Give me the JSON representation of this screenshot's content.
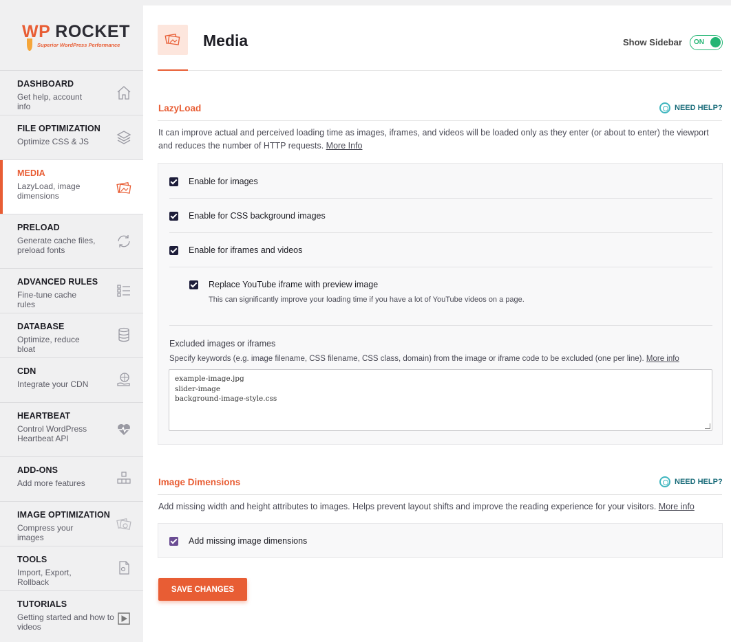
{
  "logo": {
    "part1": "WP",
    "part2": "ROCKET",
    "tagline": "Superior WordPress Performance"
  },
  "sidebar": {
    "items": [
      {
        "title": "DASHBOARD",
        "sub": "Get help, account info",
        "icon": "home-icon"
      },
      {
        "title": "FILE OPTIMIZATION",
        "sub": "Optimize CSS & JS",
        "icon": "layers-icon"
      },
      {
        "title": "MEDIA",
        "sub": "LazyLoad, image dimensions",
        "icon": "images-icon",
        "active": true
      },
      {
        "title": "PRELOAD",
        "sub": "Generate cache files, preload fonts",
        "icon": "refresh-icon"
      },
      {
        "title": "ADVANCED RULES",
        "sub": "Fine-tune cache rules",
        "icon": "checklist-icon"
      },
      {
        "title": "DATABASE",
        "sub": "Optimize, reduce bloat",
        "icon": "database-icon"
      },
      {
        "title": "CDN",
        "sub": "Integrate your CDN",
        "icon": "globe-hand-icon"
      },
      {
        "title": "HEARTBEAT",
        "sub": "Control WordPress Heartbeat API",
        "icon": "heartbeat-icon"
      },
      {
        "title": "ADD-ONS",
        "sub": "Add more features",
        "icon": "cubes-icon"
      },
      {
        "title": "IMAGE OPTIMIZATION",
        "sub": "Compress your images",
        "icon": "image-compress-icon"
      },
      {
        "title": "TOOLS",
        "sub": "Import, Export, Rollback",
        "icon": "tools-file-icon"
      },
      {
        "title": "TUTORIALS",
        "sub": "Getting started and how to videos",
        "icon": "play-icon"
      }
    ]
  },
  "header": {
    "title": "Media",
    "show_sidebar": "Show Sidebar",
    "toggle": "ON"
  },
  "lazyload": {
    "title": "LazyLoad",
    "need_help": "NEED HELP?",
    "desc": "It can improve actual and perceived loading time as images, iframes, and videos will be loaded only as they enter (or about to enter) the viewport and reduces the number of HTTP requests.",
    "more_info": "More Info",
    "opt_images": "Enable for images",
    "opt_css_bg": "Enable for CSS background images",
    "opt_iframes": "Enable for iframes and videos",
    "opt_youtube": "Replace YouTube iframe with preview image",
    "youtube_desc": "This can significantly improve your loading time if you have a lot of YouTube videos on a page.",
    "excluded_label": "Excluded images or iframes",
    "excluded_desc": "Specify keywords (e.g. image filename, CSS filename, CSS class, domain) from the image or iframe code to be excluded (one per line).",
    "excluded_more": "More info",
    "excluded_lines": [
      "example-image.jpg",
      "slider-image",
      "background-image-style.css"
    ]
  },
  "dimensions": {
    "title": "Image Dimensions",
    "need_help": "NEED HELP?",
    "desc": "Add missing width and height attributes to images. Helps prevent layout shifts and improve the reading experience for your visitors.",
    "more_info": "More info",
    "opt_add": "Add missing image dimensions"
  },
  "save_label": "SAVE CHANGES",
  "colors": {
    "accent": "#e85d34",
    "toggle_on": "#22b573",
    "help": "#1a6c7a"
  }
}
